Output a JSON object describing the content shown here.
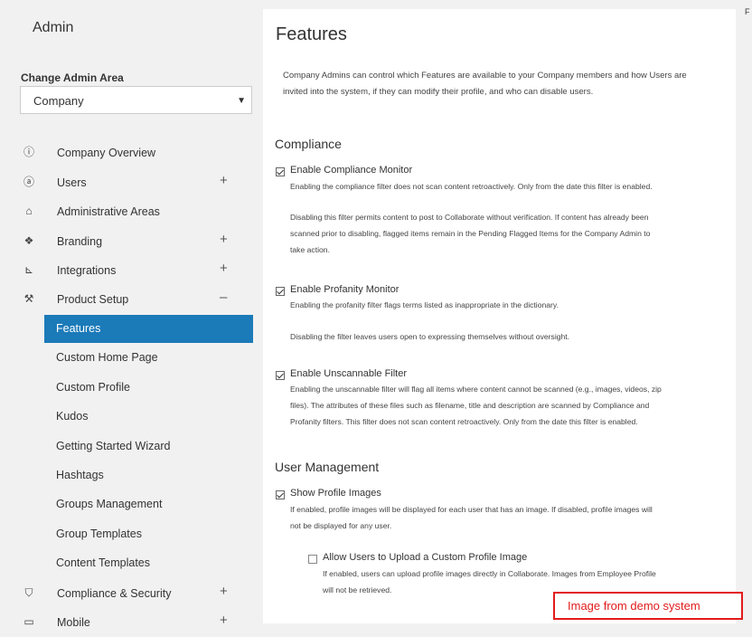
{
  "sidebar": {
    "title": "Admin",
    "change_area_label": "Change Admin Area",
    "area_select": {
      "value": "Company"
    },
    "items": [
      {
        "label": "Company Overview",
        "icon": "info-icon",
        "expand": ""
      },
      {
        "label": "Users",
        "icon": "user-icon",
        "expand": "+"
      },
      {
        "label": "Administrative Areas",
        "icon": "building-icon",
        "expand": ""
      },
      {
        "label": "Branding",
        "icon": "palette-icon",
        "expand": "+"
      },
      {
        "label": "Integrations",
        "icon": "integration-icon",
        "expand": "+"
      },
      {
        "label": "Product Setup",
        "icon": "wrench-icon",
        "expand": "–"
      },
      {
        "label": "Compliance & Security",
        "icon": "shield-icon",
        "expand": "+"
      },
      {
        "label": "Mobile",
        "icon": "mobile-icon",
        "expand": "+"
      }
    ],
    "sub_items": [
      {
        "label": "Features",
        "active": true
      },
      {
        "label": "Custom Home Page"
      },
      {
        "label": "Custom Profile"
      },
      {
        "label": "Kudos"
      },
      {
        "label": "Getting Started Wizard"
      },
      {
        "label": "Hashtags"
      },
      {
        "label": "Groups Management"
      },
      {
        "label": "Group Templates"
      },
      {
        "label": "Content Templates"
      }
    ]
  },
  "main": {
    "title": "Features",
    "intro_line1": "Company Admins can control which Features are available to your Company members and how Users are",
    "intro_line2": "invited into the system, if they can modify their profile, and who can disable users.",
    "compliance": {
      "heading": "Compliance",
      "compliance_monitor": {
        "label": "Enable Compliance Monitor",
        "checked": true,
        "lines": [
          "Enabling the compliance filter does not scan content retroactively. Only from the date this filter is enabled.",
          "Disabling this filter permits content to post to Collaborate without verification. If content has already been",
          "scanned prior to disabling, flagged items remain in the Pending Flagged Items for the Company Admin to",
          "take action."
        ]
      },
      "profanity_monitor": {
        "label": "Enable Profanity Monitor",
        "checked": true,
        "lines": [
          "Enabling the profanity filter flags terms listed as inappropriate in the dictionary.",
          "Disabling the filter leaves users open to expressing themselves without oversight."
        ]
      },
      "unscannable_filter": {
        "label": "Enable Unscannable Filter",
        "checked": true,
        "lines": [
          "Enabling the unscannable filter will flag all items where content cannot be scanned (e.g., images, videos, zip",
          "files). The attributes of these files such as filename, title and description are scanned by Compliance and",
          "Profanity filters. This filter does not scan content retroactively. Only from the date this filter is enabled."
        ]
      }
    },
    "user_management": {
      "heading": "User Management",
      "show_profile_images": {
        "label": "Show Profile Images",
        "checked": true,
        "lines": [
          "If enabled, profile images will be displayed for each user that has an image. If disabled, profile images will",
          "not be displayed for any user."
        ]
      },
      "allow_upload": {
        "label": "Allow Users to Upload a Custom Profile Image",
        "checked": false,
        "lines": [
          "If enabled, users can upload profile images directly in Collaborate. Images from Employee Profile",
          "will not be retrieved."
        ]
      }
    }
  },
  "right_strip": {
    "mark": "F"
  },
  "watermark": {
    "text": "Image from demo system",
    "color": "#e21b1b"
  },
  "colors": {
    "accent": "#1b7ab8",
    "background": "#f1f1f1"
  }
}
